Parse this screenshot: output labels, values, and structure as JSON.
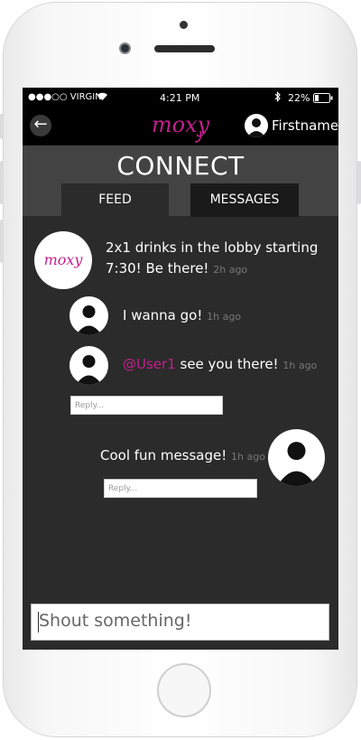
{
  "status_bar": {
    "carrier": "●●●○○ VIRGIN",
    "time": "4:21 PM",
    "battery": "22%"
  },
  "header": {
    "brand": "moxy",
    "username": "Firstname",
    "brand_color": "#c51f8d"
  },
  "connect": {
    "title": "CONNECT",
    "tabs": [
      {
        "label": "FEED",
        "active": true
      },
      {
        "label": "MESSAGES",
        "active": false
      }
    ]
  },
  "feed": {
    "post": {
      "text_line1": "2x1 drinks in the lobby starting",
      "text_line2": "7:30! Be there!",
      "time": "2h ago"
    },
    "replies": [
      {
        "text": "I wanna go!",
        "time": "1h ago"
      },
      {
        "mention": "@User1",
        "text": " see you there!",
        "time": "1h ago"
      }
    ],
    "reply_placeholder_1": "Reply...",
    "own_message": {
      "text": "Cool fun message!",
      "time": "1h ago"
    },
    "reply_placeholder_2": "Reply..."
  },
  "composer": {
    "placeholder": "Shout something!"
  }
}
